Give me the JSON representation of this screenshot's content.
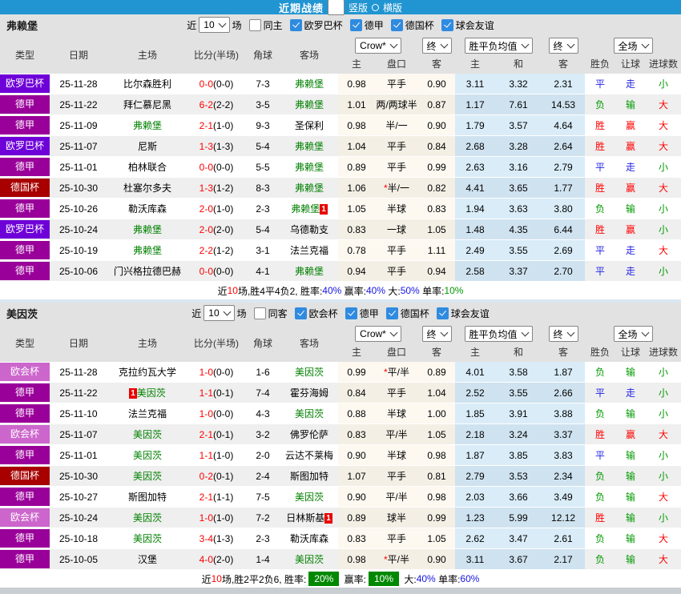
{
  "title_bar": {
    "title": "近期战绩",
    "vertical_label": "竖版",
    "horizontal_label": "横版",
    "selected_layout": "竖版"
  },
  "labels": {
    "near": "近",
    "games": "场"
  },
  "dropdowns": {
    "count": "10",
    "source": "Crow*",
    "final": "终",
    "wdl_avg": "胜平负均值",
    "final2": "终",
    "scope": "全场"
  },
  "columns": [
    "类型",
    "日期",
    "主场",
    "比分(半场)",
    "角球",
    "客场",
    "主",
    "盘口",
    "客",
    "主",
    "和",
    "客",
    "胜负",
    "让球",
    "进球数"
  ],
  "colors": {
    "titlebar": "#2095d2",
    "checkbox_checked": "#2f8be0",
    "win_red": "#ff0000",
    "draw_blue": "#2323e6",
    "lose_green": "#009900",
    "self_team_green": "#008000",
    "summary_box_green": "#008800"
  },
  "league_colors": {
    "欧罗巴杯": "#6e00d8",
    "欧会杯": "#cc66cc",
    "德甲": "#990099",
    "德国杯": "#a80000"
  },
  "result_colors": {
    "胜": "r",
    "赢": "r",
    "大": "r",
    "平": "b",
    "走": "b",
    "负": "g",
    "输": "g",
    "小": "g"
  },
  "sections": [
    {
      "team": "弗赖堡",
      "same_side_label": "同主",
      "same_side_checked": false,
      "leagues": [
        "欧罗巴杯",
        "德甲",
        "德国杯",
        "球会友谊"
      ],
      "rows": [
        {
          "league": "欧罗巴杯",
          "date": "25-11-28",
          "home": {
            "name": "比尔森胜利"
          },
          "score": "0-0",
          "half": "(0-0)",
          "corners": "7-3",
          "away": {
            "name": "弗赖堡",
            "self": true
          },
          "oh": "0.98",
          "hc": "平手",
          "oa": "0.90",
          "aw": "3.11",
          "ad": "3.32",
          "al": "2.31",
          "r1": "平",
          "r2": "走",
          "r3": "小"
        },
        {
          "league": "德甲",
          "date": "25-11-22",
          "home": {
            "name": "拜仁慕尼黑"
          },
          "score": "6-2",
          "half": "(2-2)",
          "corners": "3-5",
          "away": {
            "name": "弗赖堡",
            "self": true
          },
          "oh": "1.01",
          "hc": "两/两球半",
          "oa": "0.87",
          "aw": "1.17",
          "ad": "7.61",
          "al": "14.53",
          "r1": "负",
          "r2": "输",
          "r3": "大"
        },
        {
          "league": "德甲",
          "date": "25-11-09",
          "home": {
            "name": "弗赖堡",
            "self": true
          },
          "score": "2-1",
          "half": "(1-0)",
          "corners": "9-3",
          "away": {
            "name": "圣保利"
          },
          "oh": "0.98",
          "hc": "半/一",
          "oa": "0.90",
          "aw": "1.79",
          "ad": "3.57",
          "al": "4.64",
          "r1": "胜",
          "r2": "赢",
          "r3": "大"
        },
        {
          "league": "欧罗巴杯",
          "date": "25-11-07",
          "home": {
            "name": "尼斯"
          },
          "score": "1-3",
          "half": "(1-3)",
          "corners": "5-4",
          "away": {
            "name": "弗赖堡",
            "self": true
          },
          "oh": "1.04",
          "hc": "平手",
          "oa": "0.84",
          "aw": "2.68",
          "ad": "3.28",
          "al": "2.64",
          "r1": "胜",
          "r2": "赢",
          "r3": "大"
        },
        {
          "league": "德甲",
          "date": "25-11-01",
          "home": {
            "name": "柏林联合"
          },
          "score": "0-0",
          "half": "(0-0)",
          "corners": "5-5",
          "away": {
            "name": "弗赖堡",
            "self": true
          },
          "oh": "0.89",
          "hc": "平手",
          "oa": "0.99",
          "aw": "2.63",
          "ad": "3.16",
          "al": "2.79",
          "r1": "平",
          "r2": "走",
          "r3": "小"
        },
        {
          "league": "德国杯",
          "date": "25-10-30",
          "home": {
            "name": "杜塞尔多夫"
          },
          "score": "1-3",
          "half": "(1-2)",
          "corners": "8-3",
          "away": {
            "name": "弗赖堡",
            "self": true
          },
          "oh": "1.06",
          "star": "*",
          "hc": "半/一",
          "oa": "0.82",
          "aw": "4.41",
          "ad": "3.65",
          "al": "1.77",
          "r1": "胜",
          "r2": "赢",
          "r3": "大"
        },
        {
          "league": "德甲",
          "date": "25-10-26",
          "home": {
            "name": "勒沃库森"
          },
          "score": "2-0",
          "half": "(1-0)",
          "corners": "2-3",
          "away": {
            "name": "弗赖堡",
            "self": true,
            "badge": "1",
            "badge_pos": "post"
          },
          "oh": "1.05",
          "hc": "半球",
          "oa": "0.83",
          "aw": "1.94",
          "ad": "3.63",
          "al": "3.80",
          "r1": "负",
          "r2": "输",
          "r3": "小"
        },
        {
          "league": "欧罗巴杯",
          "date": "25-10-24",
          "home": {
            "name": "弗赖堡",
            "self": true
          },
          "score": "2-0",
          "half": "(2-0)",
          "corners": "5-4",
          "away": {
            "name": "乌德勒支"
          },
          "oh": "0.83",
          "hc": "一球",
          "oa": "1.05",
          "aw": "1.48",
          "ad": "4.35",
          "al": "6.44",
          "r1": "胜",
          "r2": "赢",
          "r3": "小"
        },
        {
          "league": "德甲",
          "date": "25-10-19",
          "home": {
            "name": "弗赖堡",
            "self": true
          },
          "score": "2-2",
          "half": "(1-2)",
          "corners": "3-1",
          "away": {
            "name": "法兰克福"
          },
          "oh": "0.78",
          "hc": "平手",
          "oa": "1.11",
          "aw": "2.49",
          "ad": "3.55",
          "al": "2.69",
          "r1": "平",
          "r2": "走",
          "r3": "大"
        },
        {
          "league": "德甲",
          "date": "25-10-06",
          "home": {
            "name": "门兴格拉德巴赫"
          },
          "score": "0-0",
          "half": "(0-0)",
          "corners": "4-1",
          "away": {
            "name": "弗赖堡",
            "self": true
          },
          "oh": "0.94",
          "hc": "平手",
          "oa": "0.94",
          "aw": "2.58",
          "ad": "3.37",
          "al": "2.70",
          "r1": "平",
          "r2": "走",
          "r3": "小"
        }
      ],
      "summary": [
        {
          "text": "近",
          "style": "k"
        },
        {
          "text": "10",
          "style": "red"
        },
        {
          "text": "场,胜4平4负2, 胜率:",
          "style": "k"
        },
        {
          "text": "40%",
          "style": "blue"
        },
        {
          "text": " 赢率:",
          "style": "k"
        },
        {
          "text": "40%",
          "style": "blue"
        },
        {
          "text": " 大:",
          "style": "k"
        },
        {
          "text": "50%",
          "style": "blue"
        },
        {
          "text": " 单率:",
          "style": "k"
        },
        {
          "text": "10%",
          "style": "green"
        }
      ]
    },
    {
      "team": "美因茨",
      "same_side_label": "同客",
      "same_side_checked": false,
      "leagues": [
        "欧会杯",
        "德甲",
        "德国杯",
        "球会友谊"
      ],
      "rows": [
        {
          "league": "欧会杯",
          "date": "25-11-28",
          "home": {
            "name": "克拉约瓦大学"
          },
          "score": "1-0",
          "half": "(0-0)",
          "corners": "1-6",
          "away": {
            "name": "美因茨",
            "self": true
          },
          "oh": "0.99",
          "star": "*",
          "hc": "平/半",
          "oa": "0.89",
          "aw": "4.01",
          "ad": "3.58",
          "al": "1.87",
          "r1": "负",
          "r2": "输",
          "r3": "小"
        },
        {
          "league": "德甲",
          "date": "25-11-22",
          "home": {
            "name": "美因茨",
            "self": true,
            "badge": "1",
            "badge_pos": "pre"
          },
          "score": "1-1",
          "half": "(0-1)",
          "corners": "7-4",
          "away": {
            "name": "霍芬海姆"
          },
          "oh": "0.84",
          "hc": "平手",
          "oa": "1.04",
          "aw": "2.52",
          "ad": "3.55",
          "al": "2.66",
          "r1": "平",
          "r2": "走",
          "r3": "小"
        },
        {
          "league": "德甲",
          "date": "25-11-10",
          "home": {
            "name": "法兰克福"
          },
          "score": "1-0",
          "half": "(0-0)",
          "corners": "4-3",
          "away": {
            "name": "美因茨",
            "self": true
          },
          "oh": "0.88",
          "hc": "半球",
          "oa": "1.00",
          "aw": "1.85",
          "ad": "3.91",
          "al": "3.88",
          "r1": "负",
          "r2": "输",
          "r3": "小"
        },
        {
          "league": "欧会杯",
          "date": "25-11-07",
          "home": {
            "name": "美因茨",
            "self": true
          },
          "score": "2-1",
          "half": "(0-1)",
          "corners": "3-2",
          "away": {
            "name": "佛罗伦萨"
          },
          "oh": "0.83",
          "hc": "平/半",
          "oa": "1.05",
          "aw": "2.18",
          "ad": "3.24",
          "al": "3.37",
          "r1": "胜",
          "r2": "赢",
          "r3": "大"
        },
        {
          "league": "德甲",
          "date": "25-11-01",
          "home": {
            "name": "美因茨",
            "self": true
          },
          "score": "1-1",
          "half": "(1-0)",
          "corners": "2-0",
          "away": {
            "name": "云达不莱梅"
          },
          "oh": "0.90",
          "hc": "半球",
          "oa": "0.98",
          "aw": "1.87",
          "ad": "3.85",
          "al": "3.83",
          "r1": "平",
          "r2": "输",
          "r3": "小"
        },
        {
          "league": "德国杯",
          "date": "25-10-30",
          "home": {
            "name": "美因茨",
            "self": true
          },
          "score": "0-2",
          "half": "(0-1)",
          "corners": "2-4",
          "away": {
            "name": "斯图加特"
          },
          "oh": "1.07",
          "hc": "平手",
          "oa": "0.81",
          "aw": "2.79",
          "ad": "3.53",
          "al": "2.34",
          "r1": "负",
          "r2": "输",
          "r3": "小"
        },
        {
          "league": "德甲",
          "date": "25-10-27",
          "home": {
            "name": "斯图加特"
          },
          "score": "2-1",
          "half": "(1-1)",
          "corners": "7-5",
          "away": {
            "name": "美因茨",
            "self": true
          },
          "oh": "0.90",
          "hc": "平/半",
          "oa": "0.98",
          "aw": "2.03",
          "ad": "3.66",
          "al": "3.49",
          "r1": "负",
          "r2": "输",
          "r3": "大"
        },
        {
          "league": "欧会杯",
          "date": "25-10-24",
          "home": {
            "name": "美因茨",
            "self": true
          },
          "score": "1-0",
          "half": "(1-0)",
          "corners": "7-2",
          "away": {
            "name": "日林斯基",
            "badge": "1",
            "badge_pos": "post"
          },
          "oh": "0.89",
          "hc": "球半",
          "oa": "0.99",
          "aw": "1.23",
          "ad": "5.99",
          "al": "12.12",
          "r1": "胜",
          "r2": "输",
          "r3": "小"
        },
        {
          "league": "德甲",
          "date": "25-10-18",
          "home": {
            "name": "美因茨",
            "self": true
          },
          "score": "3-4",
          "half": "(1-3)",
          "corners": "2-3",
          "away": {
            "name": "勒沃库森"
          },
          "oh": "0.83",
          "hc": "平手",
          "oa": "1.05",
          "aw": "2.62",
          "ad": "3.47",
          "al": "2.61",
          "r1": "负",
          "r2": "输",
          "r3": "大"
        },
        {
          "league": "德甲",
          "date": "25-10-05",
          "home": {
            "name": "汉堡"
          },
          "score": "4-0",
          "half": "(2-0)",
          "corners": "1-4",
          "away": {
            "name": "美因茨",
            "self": true
          },
          "oh": "0.98",
          "star": "*",
          "hc": "平/半",
          "oa": "0.90",
          "aw": "3.11",
          "ad": "3.67",
          "al": "2.17",
          "r1": "负",
          "r2": "输",
          "r3": "大"
        }
      ],
      "summary": [
        {
          "text": "近",
          "style": "k"
        },
        {
          "text": "10",
          "style": "red"
        },
        {
          "text": "场,胜2平2负6, 胜率:",
          "style": "k"
        },
        {
          "text": "20%",
          "style": "greenbox"
        },
        {
          "text": " 赢率:",
          "style": "k"
        },
        {
          "text": "10%",
          "style": "greenbox"
        },
        {
          "text": " 大:",
          "style": "k"
        },
        {
          "text": "40%",
          "style": "blue"
        },
        {
          "text": " 单率:",
          "style": "k"
        },
        {
          "text": "60%",
          "style": "blue"
        }
      ]
    }
  ]
}
